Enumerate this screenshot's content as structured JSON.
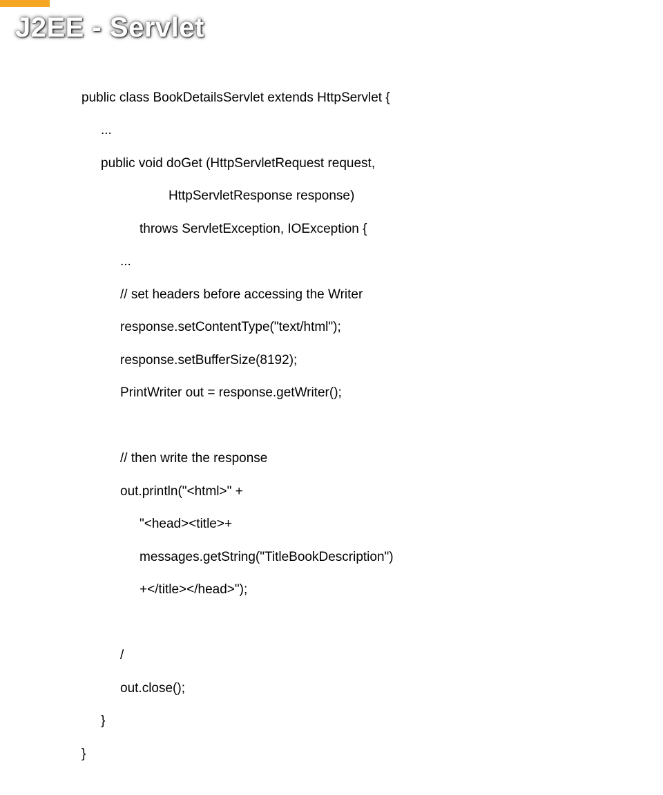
{
  "slide": {
    "title": "J2EE - Servlet",
    "code": {
      "l01": "public class BookDetailsServlet extends HttpServlet {",
      "l02": "...",
      "l03": "public void doGet (HttpServletRequest request,",
      "l04": "HttpServletResponse response)",
      "l05": "throws ServletException, IOException {",
      "l06": "...",
      "l07": "// set headers before accessing the Writer",
      "l08": "response.setContentType(\"text/html\");",
      "l09": "response.setBufferSize(8192);",
      "l10": "PrintWriter out = response.getWriter();",
      "l11": "",
      "l12": "// then write the response",
      "l13": "out.println(\"<html>\" +",
      "l14": "\"<head><title>+",
      "l15": "messages.getString(\"TitleBookDescription\")",
      "l16": "+</title></head>\");",
      "l17": "",
      "l18": "/",
      "l19": "out.close();",
      "l20": "}",
      "l21": "}"
    }
  }
}
